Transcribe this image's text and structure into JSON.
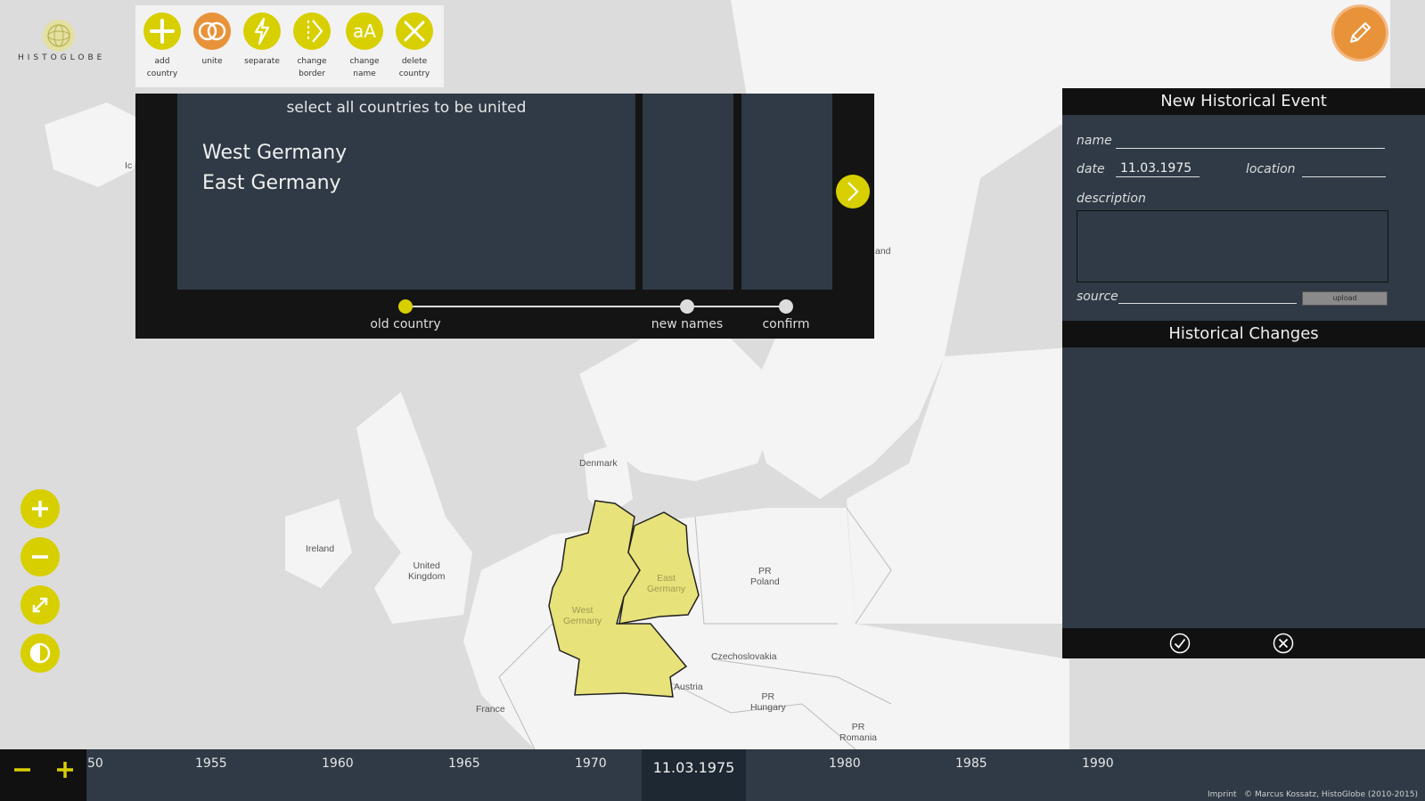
{
  "app": {
    "name": "HistoGlobe"
  },
  "toolbar": {
    "tools": [
      {
        "label": "add\ncountry"
      },
      {
        "label": "unite"
      },
      {
        "label": "separate"
      },
      {
        "label": "change\nborder"
      },
      {
        "label": "change\nname"
      },
      {
        "label": "delete\ncountry"
      }
    ]
  },
  "wizard": {
    "instruction": "select all countries to be united",
    "selected_countries": [
      "West Germany",
      "East Germany"
    ],
    "steps": [
      "old country",
      "new names",
      "confirm"
    ],
    "active_step": 0
  },
  "event_panel": {
    "title": "New Historical Event",
    "name_label": "name",
    "name_value": "",
    "date_label": "date",
    "date_value": "11.03.1975",
    "location_label": "location",
    "location_value": "",
    "description_label": "description",
    "source_label": "source",
    "upload_label": "upload",
    "changes_title": "Historical Changes"
  },
  "map": {
    "labels": [
      {
        "text": "Denmark"
      },
      {
        "text": "Ireland"
      },
      {
        "text": "United\nKingdom"
      },
      {
        "text": "East\nGermany"
      },
      {
        "text": "West\nGermany"
      },
      {
        "text": "PR\nPoland"
      },
      {
        "text": "Czechoslovakia"
      },
      {
        "text": "Austria"
      },
      {
        "text": "PR\nHungary"
      },
      {
        "text": "France"
      },
      {
        "text": "PR\nRomania"
      },
      {
        "text": "Ic"
      },
      {
        "text": "and"
      }
    ]
  },
  "timeline": {
    "ticks": [
      "50",
      "1955",
      "1960",
      "1965",
      "1970",
      "1980",
      "1985",
      "1990"
    ],
    "current_date": "11.03.1975"
  },
  "footer": {
    "imprint": "Imprint",
    "copyright": "© Marcus Kossatz, HistoGlobe (2010-2015)"
  },
  "colors": {
    "accent": "#d8cf00",
    "orange": "#e8933a",
    "panel": "#2f3a46",
    "selected_country": "#e8e27a"
  }
}
